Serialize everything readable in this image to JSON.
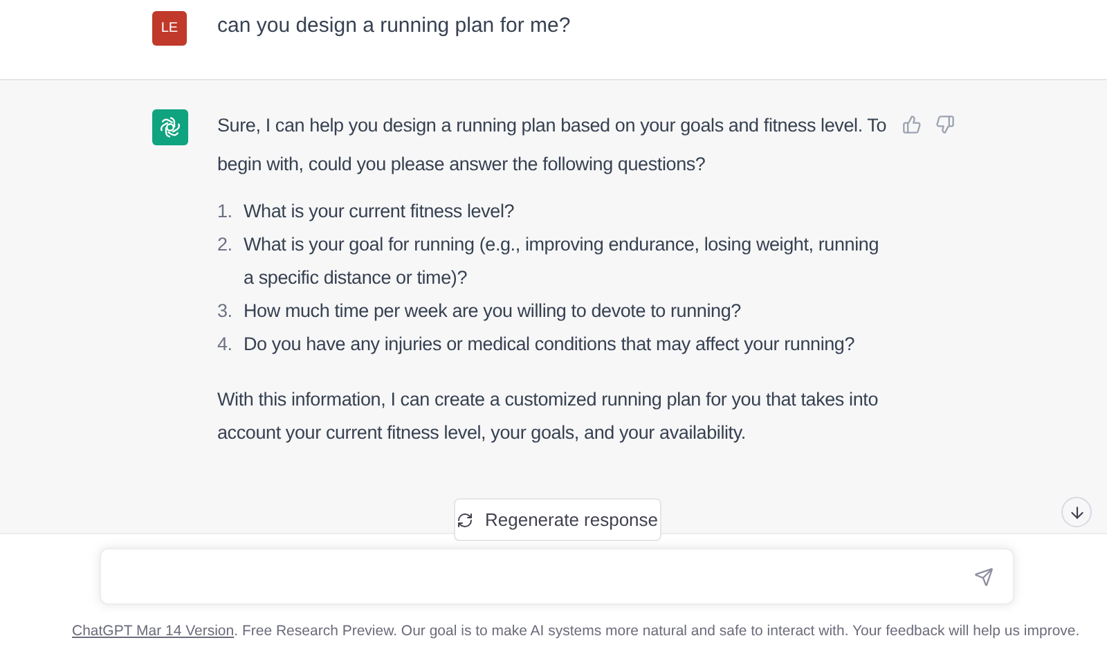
{
  "user_message": {
    "avatar": "LE",
    "text": "can you design a running plan for me?"
  },
  "assistant_message": {
    "intro": "Sure, I can help you design a running plan based on your goals and fitness level. To begin with, could you please answer the following questions?",
    "questions": [
      {
        "number": "1.",
        "text": "What is your current fitness level?"
      },
      {
        "number": "2.",
        "text": "What is your goal for running (e.g., improving endurance, losing weight, running a specific distance or time)?"
      },
      {
        "number": "3.",
        "text": "How much time per week are you willing to devote to running?"
      },
      {
        "number": "4.",
        "text": "Do you have any injuries or medical conditions that may affect your running?"
      }
    ],
    "closing": "With this information, I can create a customized running plan for you that takes into account your current fitness level, your goals, and your availability."
  },
  "regenerate_button": "Regenerate response",
  "footer": {
    "link": "ChatGPT Mar 14 Version",
    "text": ". Free Research Preview. Our goal is to make AI systems more natural and safe to interact with. Your feedback will help us improve."
  }
}
